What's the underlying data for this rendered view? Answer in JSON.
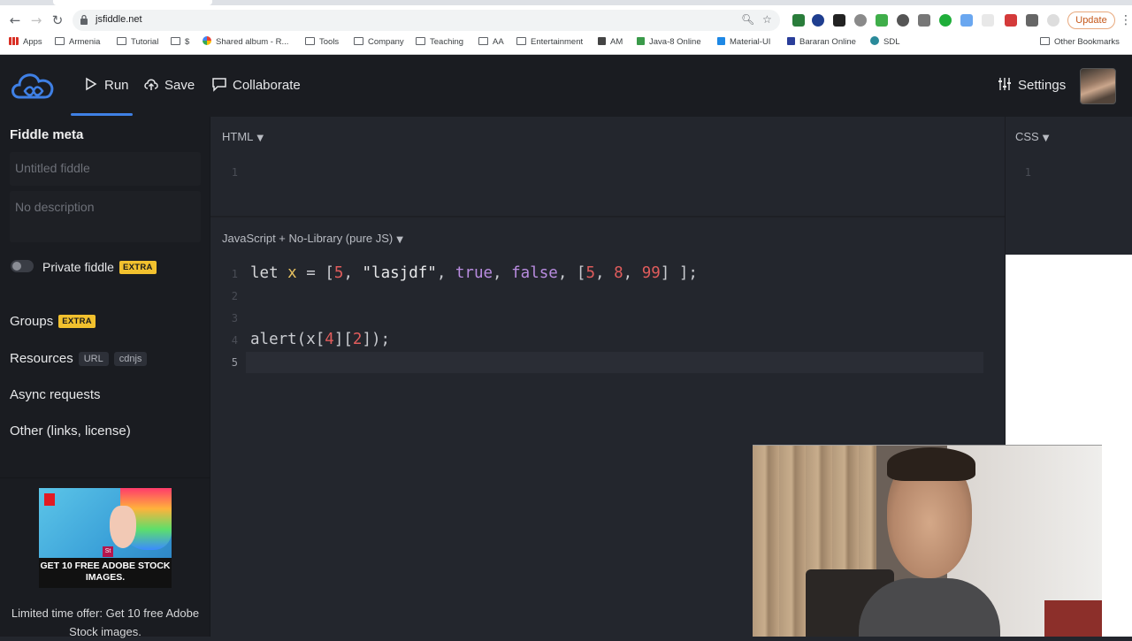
{
  "browser": {
    "url": "jsfiddle.net",
    "update_label": "Update",
    "bookmarks": [
      {
        "label": "Apps",
        "icon": "apps-grid-icon"
      },
      {
        "label": "Armenia",
        "icon": "folder-icon"
      },
      {
        "label": "Tutorial",
        "icon": "folder-icon"
      },
      {
        "label": "$",
        "icon": "folder-icon"
      },
      {
        "label": "Shared album - R...",
        "icon": "photos-icon"
      },
      {
        "label": "Tools",
        "icon": "folder-icon"
      },
      {
        "label": "Company",
        "icon": "folder-icon"
      },
      {
        "label": "Teaching",
        "icon": "folder-icon"
      },
      {
        "label": "AA",
        "icon": "folder-icon"
      },
      {
        "label": "Entertainment",
        "icon": "folder-icon"
      },
      {
        "label": "AM",
        "icon": "am-icon"
      },
      {
        "label": "Java-8 Online",
        "icon": "code-icon"
      },
      {
        "label": "Material-UI",
        "icon": "material-ui-icon"
      },
      {
        "label": "Bararan Online",
        "icon": "bararan-icon"
      },
      {
        "label": "SDL",
        "icon": "sdl-icon"
      }
    ],
    "other_bookmarks": "Other Bookmarks"
  },
  "header": {
    "run": "Run",
    "save": "Save",
    "collaborate": "Collaborate",
    "settings": "Settings"
  },
  "sidebar": {
    "title": "Fiddle meta",
    "title_placeholder": "Untitled fiddle",
    "description_placeholder": "No description",
    "private_label": "Private fiddle",
    "extra_badge": "EXTRA",
    "groups": "Groups",
    "resources": "Resources",
    "resources_url": "URL",
    "resources_cdnjs": "cdnjs",
    "async": "Async requests",
    "other": "Other (links, license)",
    "ad_text": "GET 10 FREE ADOBE STOCK IMAGES.",
    "ad_caption": "Limited time offer: Get 10 free Adobe Stock images."
  },
  "editors": {
    "html_label": "HTML",
    "js_label": "JavaScript + No-Library (pure JS)",
    "css_label": "CSS",
    "caret": "▼",
    "html_line_numbers": [
      "1"
    ],
    "css_line_numbers": [
      "1"
    ],
    "js_line_numbers": [
      "1",
      "2",
      "3",
      "4",
      "5"
    ],
    "js_code": {
      "line1": {
        "kw": "let",
        "var": "x",
        "op": "=",
        "open": "[",
        "n1": "5",
        "s1": "\"lasjdf\"",
        "b1": "true",
        "b2": "false",
        "open2": "[",
        "n2": "5",
        "n3": "8",
        "n4": "99",
        "close": "] ];"
      },
      "line4": {
        "fn": "alert(x[",
        "i1": "4",
        "mid": "][",
        "i2": "2",
        "end": "]);"
      }
    }
  },
  "colors": {
    "accent": "#3f80e5",
    "extra_badge": "#f2c12e",
    "number": "#e05c5c",
    "boolean": "#b98ce0",
    "variable": "#e8c260"
  }
}
